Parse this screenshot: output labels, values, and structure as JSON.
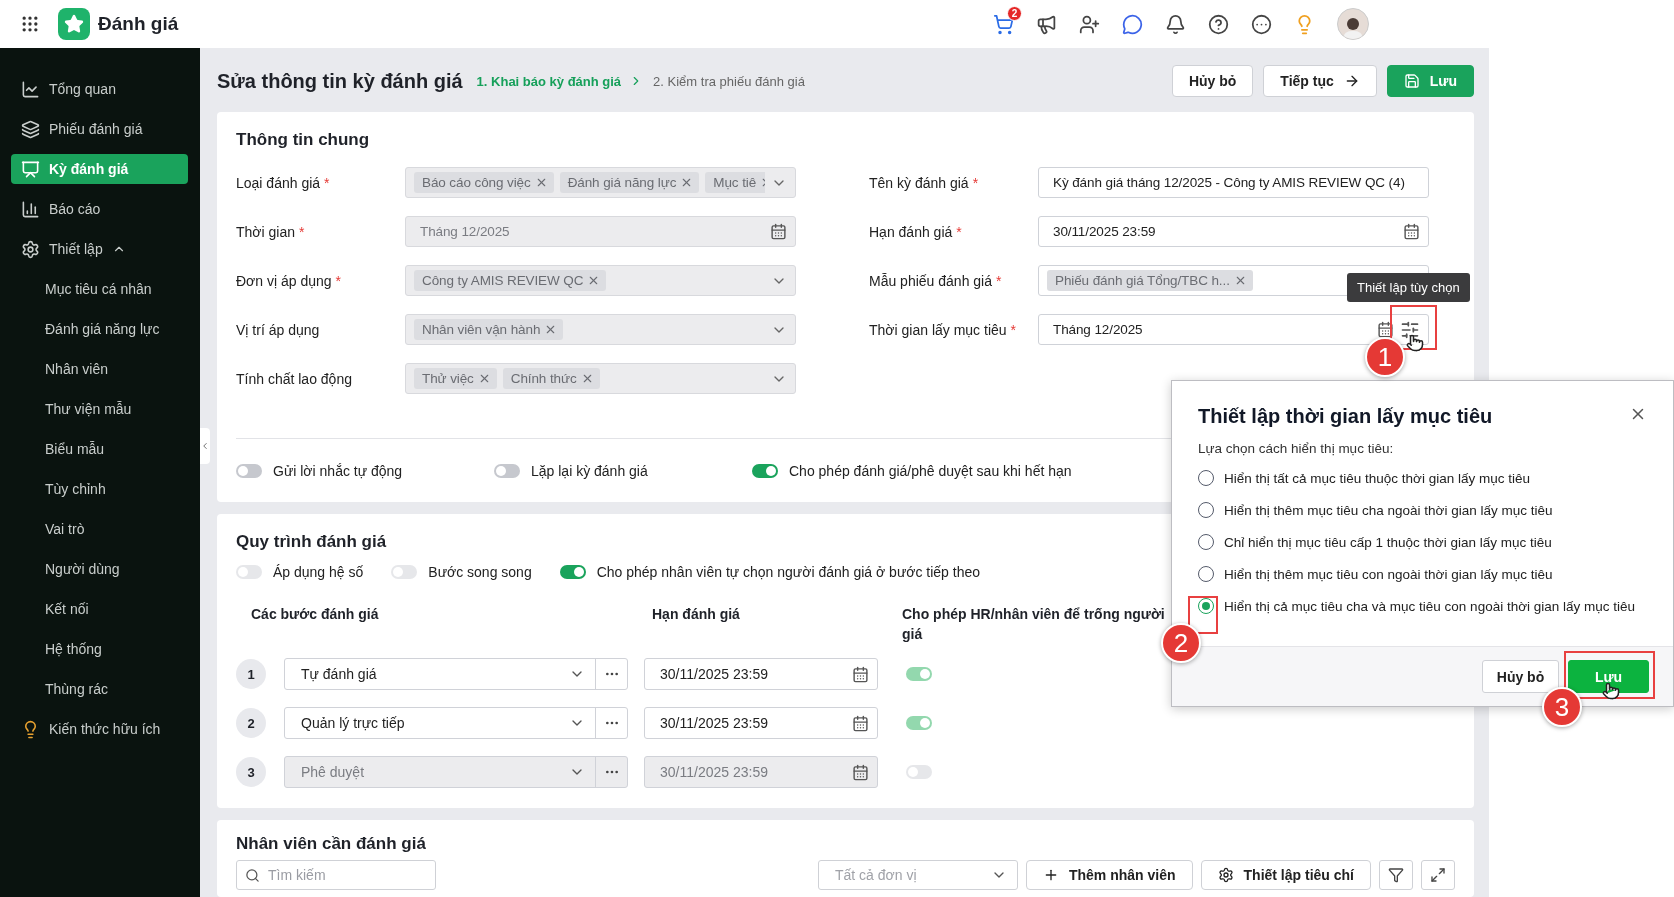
{
  "app": {
    "title": "Đánh giá",
    "cart_badge": "2"
  },
  "sidebar": {
    "items": [
      {
        "label": "Tổng quan",
        "selected": false
      },
      {
        "label": "Phiếu đánh giá",
        "selected": false
      },
      {
        "label": "Kỳ đánh giá",
        "selected": true
      },
      {
        "label": "Báo cáo",
        "selected": false
      },
      {
        "label": "Thiết lập",
        "selected": false,
        "expanded": true,
        "children": [
          {
            "label": "Mục tiêu cá nhân",
            "selected": false
          },
          {
            "label": "Đánh giá năng lực",
            "selected": false
          },
          {
            "label": "Nhân viên",
            "selected": false
          },
          {
            "label": "Thư viện mẫu",
            "selected": false
          },
          {
            "label": "Biểu mẫu",
            "selected": false
          },
          {
            "label": "Tùy chỉnh",
            "selected": false
          },
          {
            "label": "Vai trò",
            "selected": false
          },
          {
            "label": "Người dùng",
            "selected": false
          },
          {
            "label": "Kết nối",
            "selected": false
          },
          {
            "label": "Hệ thống",
            "selected": false
          },
          {
            "label": "Thùng rác",
            "selected": false
          }
        ]
      },
      {
        "label": "Kiến thức hữu ích",
        "selected": false
      }
    ]
  },
  "page": {
    "title": "Sửa thông tin kỳ đánh giá",
    "steps": [
      {
        "label": "1. Khai báo kỳ đánh giá",
        "selected": true
      },
      {
        "label": "2. Kiểm tra phiếu đánh giá",
        "selected": false
      }
    ],
    "buttons": [
      {
        "label": "Hủy bỏ",
        "kind": "secondary"
      },
      {
        "label": "Tiếp tục",
        "kind": "next"
      },
      {
        "label": "Lưu",
        "kind": "primary"
      }
    ]
  },
  "general": {
    "title": "Thông tin chung",
    "left_fields": [
      {
        "label": "Loại đánh giá",
        "required_mark": "*",
        "kind": "tags",
        "disabled": true,
        "tags": [
          "Báo cáo công việc",
          "Đánh giá năng lực",
          "Mục tiê"
        ]
      },
      {
        "label": "Thời gian",
        "required_mark": "*",
        "kind": "date",
        "disabled": true,
        "value": "Tháng 12/2025"
      },
      {
        "label": "Đơn vị áp dụng",
        "required_mark": "*",
        "kind": "tags",
        "disabled": true,
        "tags": [
          "Công ty AMIS REVIEW QC"
        ]
      },
      {
        "label": "Vị trí áp dụng",
        "kind": "tags",
        "disabled": true,
        "tags": [
          "Nhân viên vận hành"
        ]
      },
      {
        "label": "Tính chất lao động",
        "kind": "tags",
        "disabled": true,
        "tags": [
          "Thử việc",
          "Chính thức"
        ]
      }
    ],
    "right_fields": [
      {
        "label": "Tên kỳ đánh giá",
        "required_mark": "*",
        "kind": "text",
        "disabled": false,
        "value": "Kỳ đánh giá tháng 12/2025 - Công ty AMIS REVIEW QC (4)"
      },
      {
        "label": "Hạn đánh giá",
        "required_mark": "*",
        "kind": "date",
        "disabled": false,
        "value": "30/11/2025 23:59"
      },
      {
        "label": "Mẫu phiếu đánh giá",
        "required_mark": "*",
        "kind": "tags",
        "disabled": false,
        "tags": [
          "Phiếu đánh giá Tổng/TBC h..."
        ]
      },
      {
        "label": "Thời gian lấy mục tiêu",
        "required_mark": "*",
        "kind": "date_settings",
        "disabled": false,
        "value": "Tháng 12/2025"
      }
    ],
    "toggles": [
      {
        "label": "Gửi lời nhắc tự động",
        "on": false
      },
      {
        "label": "Lặp lại kỳ đánh giá",
        "on": false
      },
      {
        "label": "Cho phép đánh giá/phê duyệt sau khi hết hạn",
        "on": true
      }
    ]
  },
  "process": {
    "title": "Quy trình đánh giá",
    "toggles": [
      {
        "label": "Áp dụng hệ số",
        "on": false
      },
      {
        "label": "Bước song song",
        "on": false
      },
      {
        "label": "Cho phép nhân viên tự chọn người đánh giá ở bước tiếp theo",
        "on": true
      }
    ],
    "columns": [
      "Các bước đánh giá",
      "Hạn đánh giá",
      "Cho phép HR/nhân viên để trống người giá"
    ],
    "steps": [
      {
        "number": "1",
        "name": "Tự đánh giá",
        "deadline": "30/11/2025 23:59",
        "allow_empty": true,
        "disabled": false
      },
      {
        "number": "2",
        "name": "Quản lý trực tiếp",
        "deadline": "30/11/2025 23:59",
        "allow_empty": true,
        "disabled": false
      },
      {
        "number": "3",
        "name": "Phê duyệt",
        "deadline": "30/11/2025 23:59",
        "allow_empty": false,
        "disabled": true
      }
    ]
  },
  "employees": {
    "title": "Nhân viên cần đánh giá",
    "search_placeholder": "Tìm kiếm",
    "unit_placeholder": "Tất cả đơn vị",
    "buttons": [
      {
        "label": "Thêm nhân viên",
        "kind": "add"
      },
      {
        "label": "Thiết lập tiêu chí",
        "kind": "settings"
      }
    ]
  },
  "tooltip": {
    "text": "Thiết lập tùy chọn"
  },
  "dialog": {
    "title": "Thiết lập thời gian lấy mục tiêu",
    "subtitle": "Lựa chọn cách hiển thị mục tiêu:",
    "options": [
      {
        "label": "Hiển thị tất cả mục tiêu thuộc thời gian lấy mục tiêu",
        "selected": false
      },
      {
        "label": "Hiển thị thêm mục tiêu cha ngoài thời gian lấy mục tiêu",
        "selected": false
      },
      {
        "label": "Chỉ hiển thị mục tiêu cấp 1 thuộc thời gian lấy mục tiêu",
        "selected": false
      },
      {
        "label": "Hiển thị thêm mục tiêu con ngoài thời gian lấy mục tiêu",
        "selected": false
      },
      {
        "label": "Hiển thị cả mục tiêu cha và mục tiêu con ngoài thời gian lấy mục tiêu",
        "selected": true
      }
    ],
    "buttons": [
      {
        "label": "Hủy bỏ",
        "kind": "secondary"
      },
      {
        "label": "Lưu",
        "kind": "primary"
      }
    ]
  },
  "annotations": [
    {
      "label": "1"
    },
    {
      "label": "2"
    },
    {
      "label": "3"
    }
  ]
}
